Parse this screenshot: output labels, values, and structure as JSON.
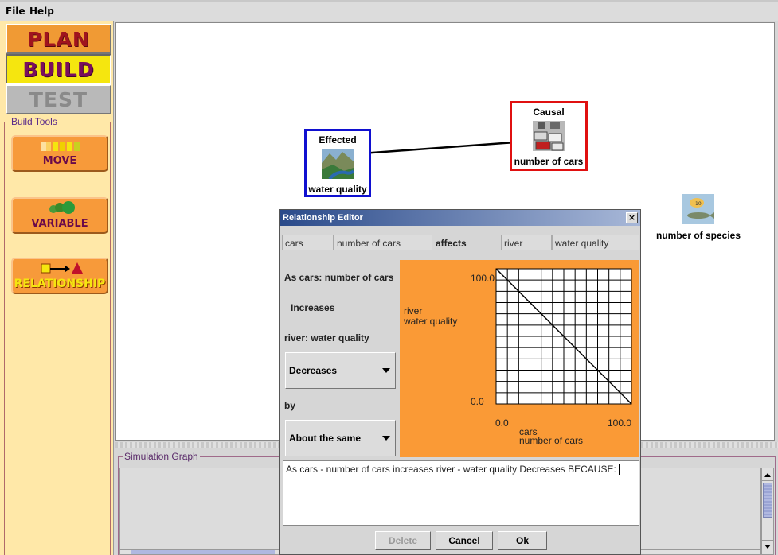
{
  "menu": {
    "file": "File",
    "help": "Help"
  },
  "modes": {
    "plan": "PLAN",
    "build": "BUILD",
    "test": "TEST"
  },
  "build_tools": {
    "legend": "Build Tools",
    "move": "MOVE",
    "variable": "VARIABLE",
    "relationship": "RELATIONSHIP"
  },
  "canvas": {
    "effected_node": {
      "role": "Effected",
      "name": "water quality"
    },
    "causal_node": {
      "role": "Causal",
      "name": "number of cars"
    },
    "free_node": {
      "name": "number of species"
    }
  },
  "simulation": {
    "legend": "Simulation Graph"
  },
  "dialog": {
    "title": "Relationship Editor",
    "close": "×",
    "cause_object": "cars",
    "cause_variable": "number of cars",
    "affects": "affects",
    "effect_object": "river",
    "effect_variable": "water quality",
    "as_label": "As cars: number of cars",
    "direction_cause": "Increases",
    "effect_label": "river: water quality",
    "direction_effect": "Decreases",
    "by_label": "by",
    "amount": "About the same",
    "graph": {
      "y_label_1": "river",
      "y_label_2": "water quality",
      "y_max": "100.0",
      "y_min": "0.0",
      "x_min": "0.0",
      "x_max": "100.0",
      "x_label_1": "cars",
      "x_label_2": "number of cars"
    },
    "reason_text": "As cars - number of cars increases river - water quality Decreases BECAUSE:",
    "buttons": {
      "delete": "Delete",
      "cancel": "Cancel",
      "ok": "Ok"
    }
  },
  "colors": {
    "effected_border": "#1010d0",
    "causal_border": "#e01010",
    "graph_bg": "#fa9a36"
  }
}
